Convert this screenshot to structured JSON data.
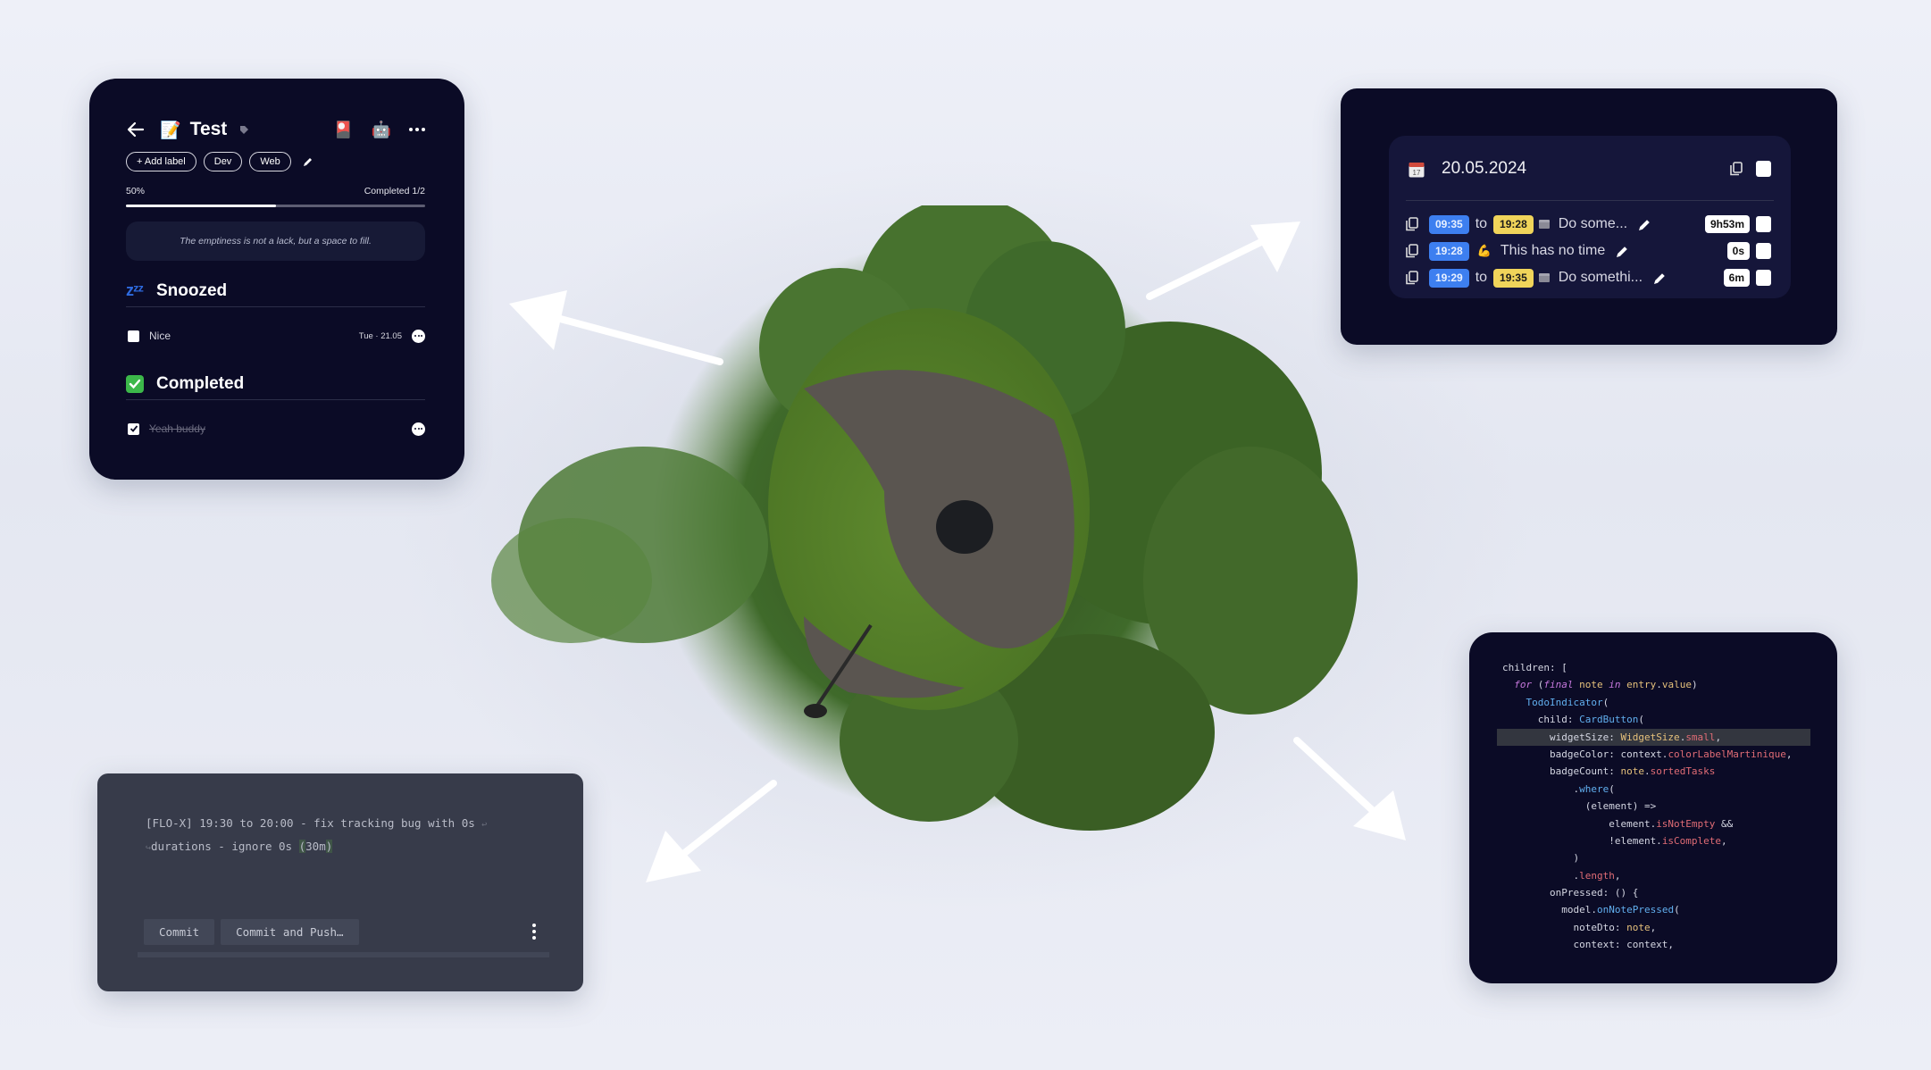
{
  "todo_panel": {
    "title_emoji": "📝",
    "title": "Test",
    "header_icons": [
      "cards-emoji",
      "robot-emoji",
      "more-horizontal-icon"
    ],
    "labels": [
      "+ Add label",
      "Dev",
      "Web"
    ],
    "progress_label": "50%",
    "progress_fraction": 0.5,
    "completed_label": "Completed 1/2",
    "quote": "The emptiness is not a lack, but a space to fill.",
    "sections": [
      {
        "title": "Snoozed",
        "icon": "zzz",
        "items": [
          {
            "name": "Nice",
            "checked": false,
            "date": "Tue · 21.05"
          }
        ]
      },
      {
        "title": "Completed",
        "icon": "check-mark-button",
        "items": [
          {
            "name": "Yeah buddy",
            "checked": true,
            "date": ""
          }
        ]
      }
    ]
  },
  "tracker_panel": {
    "date": "20.05.2024",
    "entries": [
      {
        "start": "09:35",
        "to": "to",
        "end": "19:28",
        "icon": "calendar-card",
        "description": "Do some...",
        "duration": "9h53m"
      },
      {
        "start": "19:28",
        "to": "",
        "end": "",
        "icon": "flexed-biceps",
        "description": "This has no time",
        "duration": "0s"
      },
      {
        "start": "19:29",
        "to": "to",
        "end": "19:35",
        "icon": "calendar-card",
        "description": "Do somethi...",
        "duration": "6m"
      }
    ]
  },
  "commit_panel": {
    "message_line1": "[FLO-X] 19:30 to 20:00 - fix tracking bug with 0s",
    "message_line2_pre": "durations - ignore 0s ",
    "message_line2_open": "(",
    "message_line2_mid": "30m",
    "message_line2_close": ")",
    "commit_label": "Commit",
    "commit_push_label": "Commit and Push…"
  },
  "code_panel": {
    "lines": [
      [
        [
          "",
          "children: ["
        ]
      ],
      [
        [
          "",
          "  "
        ],
        [
          "k",
          "for"
        ],
        [
          "",
          " ("
        ],
        [
          "k",
          "final"
        ],
        [
          "",
          " "
        ],
        [
          "y",
          "note"
        ],
        [
          "",
          " "
        ],
        [
          "k",
          "in"
        ],
        [
          "",
          " "
        ],
        [
          "y",
          "entry"
        ],
        [
          "",
          "."
        ],
        [
          "y",
          "value"
        ],
        [
          "",
          ")"
        ]
      ],
      [
        [
          "",
          "    "
        ],
        [
          "b",
          "TodoIndicator"
        ],
        [
          "",
          "("
        ]
      ],
      [
        [
          "",
          "      child: "
        ],
        [
          "b",
          "CardButton"
        ],
        [
          "",
          "("
        ]
      ],
      [
        [
          "",
          "        widgetSize: "
        ],
        [
          "y",
          "WidgetSize"
        ],
        [
          "",
          "."
        ],
        [
          "r",
          "small"
        ],
        [
          "",
          ","
        ]
      ],
      [
        [
          "",
          "        badgeColor: context."
        ],
        [
          "r",
          "colorLabelMartinique"
        ],
        [
          "",
          ","
        ]
      ],
      [
        [
          "",
          "        badgeCount: "
        ],
        [
          "y",
          "note"
        ],
        [
          "",
          "."
        ],
        [
          "r",
          "sortedTasks"
        ]
      ],
      [
        [
          "",
          "            ."
        ],
        [
          "b",
          "where"
        ],
        [
          "",
          "("
        ]
      ],
      [
        [
          "",
          "              (element) =>"
        ]
      ],
      [
        [
          "",
          "                  element."
        ],
        [
          "r",
          "isNotEmpty"
        ],
        [
          "",
          " &&"
        ]
      ],
      [
        [
          "",
          "                  !element."
        ],
        [
          "r",
          "isComplete"
        ],
        [
          "",
          ","
        ]
      ],
      [
        [
          "",
          "            )"
        ]
      ],
      [
        [
          "",
          "            ."
        ],
        [
          "r",
          "length"
        ],
        [
          "",
          ","
        ]
      ],
      [
        [
          "",
          "        onPressed: () {"
        ]
      ],
      [
        [
          "",
          "          model."
        ],
        [
          "b",
          "onNotePressed"
        ],
        [
          "",
          "("
        ]
      ],
      [
        [
          "",
          "            noteDto: "
        ],
        [
          "y",
          "note"
        ],
        [
          "",
          ","
        ]
      ],
      [
        [
          "",
          "            context: context,"
        ]
      ]
    ],
    "highlighted_line": 4
  },
  "colors": {
    "panel_dark": "#0b0b26",
    "time_start": "#3d7ff0",
    "time_end": "#f0d45a",
    "commit_bg": "#373b4a"
  }
}
